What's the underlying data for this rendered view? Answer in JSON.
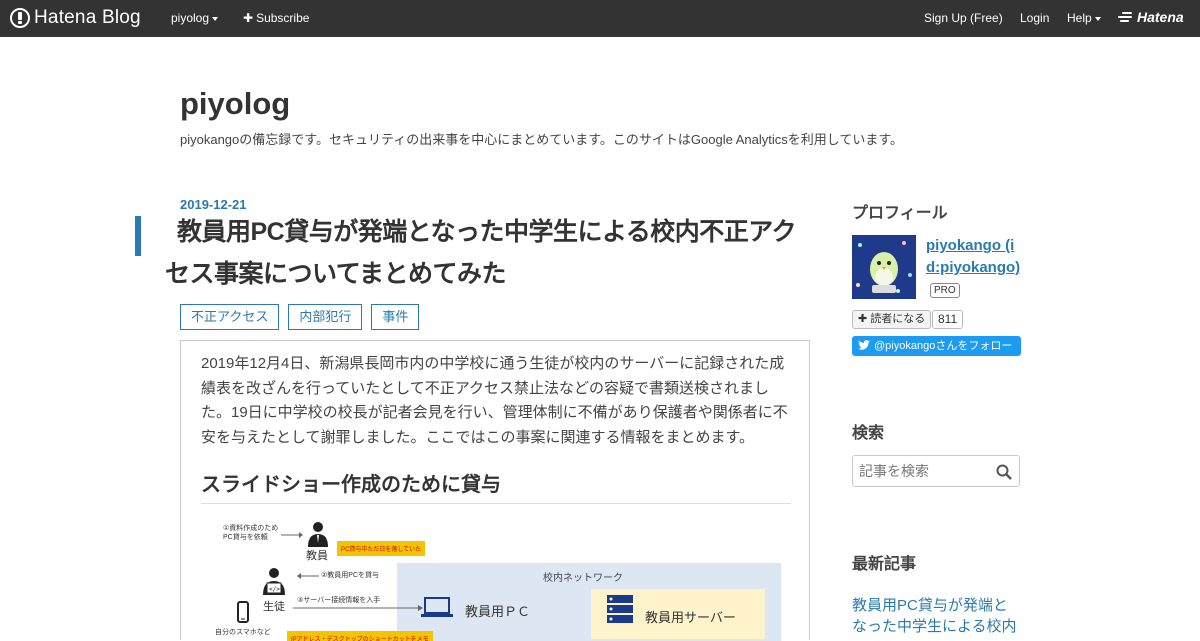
{
  "topbar": {
    "logo_text": "Hatena Blog",
    "blog_menu": "piyolog",
    "subscribe": "Subscribe",
    "signup": "Sign Up (Free)",
    "login": "Login",
    "help": "Help",
    "hatena": "Hatena"
  },
  "blog": {
    "title": "piyolog",
    "description": "piyokangoの備忘録です。セキュリティの出来事を中心にまとめています。このサイトはGoogle Analyticsを利用しています。"
  },
  "entry": {
    "date": "2019-12-21",
    "title": "教員用PC貸与が発端となった中学生による校内不正アクセス事案についてまとめてみた",
    "categories": [
      "不正アクセス",
      "内部犯行",
      "事件"
    ],
    "intro": "2019年12月4日、新潟県長岡市内の中学校に通う生徒が校内のサーバーに記録された成績表を改ざんを行っていたとして不正アクセス禁止法などの容疑で書類送検されました。19日に中学校の校長が記者会見を行い、管理体制に不備があり保護者や関係者に不安を与えたとして謝罪しました。ここではこの事案に関連する情報をまとめます。",
    "heading": "スライドショー作成のために貸与",
    "diagram": {
      "step1": "①資料作成のため\nPC貸与を依頼",
      "teacher": "教員",
      "note1": "PC貸与中ただ日を落していた",
      "step2": "②教員用PCを貸与",
      "network": "校内ネットワーク",
      "student": "生徒",
      "step3": "③サーバー接続情報を入手",
      "teacher_pc": "教員用ＰＣ",
      "server": "教員用サーバー",
      "phone": "自分のスマホなど",
      "note2": "IPアドレス・デスクトップのショートカットをメモ"
    }
  },
  "sidebar": {
    "profile_heading": "プロフィール",
    "profile_name": "piyokango (id:piyokango)",
    "pro_badge": "PRO",
    "reader_button": "読者になる",
    "reader_count": "811",
    "twitter_follow": "@piyokangoさんをフォロー",
    "search_heading": "検索",
    "search_placeholder": "記事を検索",
    "recent_heading": "最新記事",
    "recent_link": "教員用PC貸与が発端となった中学生による校内"
  },
  "colors": {
    "topbar_bg": "#333333",
    "accent": "#2a7ab0",
    "twitter": "#1d9bf0"
  }
}
